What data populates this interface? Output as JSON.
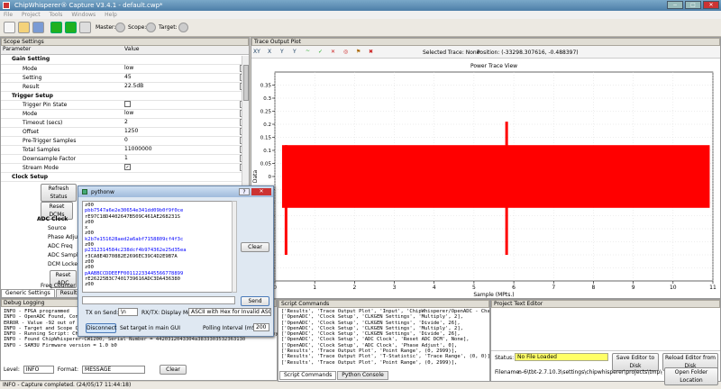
{
  "window": {
    "title": "ChipWhisperer® Capture V3.4.1 - default.cwp*",
    "minimize": "−",
    "maximize": "□",
    "close": "✕"
  },
  "menu": [
    "File",
    "Project",
    "Tools",
    "Windows",
    "Help"
  ],
  "toolbar": {
    "master_label": "Master:",
    "scope_label": "Scope:",
    "target_label": "Target:"
  },
  "scope_settings": {
    "title": "Scope Settings",
    "col_param": "Parameter",
    "col_value": "Value",
    "rows": [
      {
        "label": "Gain Setting",
        "value": "",
        "section": true,
        "indent": 1
      },
      {
        "label": "Mode",
        "value": "low",
        "indent": 2,
        "q": true
      },
      {
        "label": "Setting",
        "value": "45",
        "indent": 2,
        "q": true
      },
      {
        "label": "Result",
        "value": "22.5dB",
        "indent": 2,
        "q": true
      },
      {
        "label": "Trigger Setup",
        "value": "",
        "section": true,
        "indent": 1
      },
      {
        "label": "Trigger Pin State",
        "value": "",
        "indent": 2,
        "q": true,
        "chk": true
      },
      {
        "label": "Mode",
        "value": "low",
        "indent": 2,
        "q": true
      },
      {
        "label": "Timeout (secs)",
        "value": "2",
        "indent": 2,
        "q": true
      },
      {
        "label": "Offset",
        "value": "1250",
        "indent": 2,
        "q": true
      },
      {
        "label": "Pre-Trigger Samples",
        "value": "0",
        "indent": 2,
        "q": true
      },
      {
        "label": "Total Samples",
        "value": "11000000",
        "indent": 2,
        "q": true
      },
      {
        "label": "Downsample Factor",
        "value": "1",
        "indent": 2,
        "q": true
      },
      {
        "label": "Stream Mode",
        "value": "✓",
        "indent": 2,
        "q": true,
        "chk": true
      },
      {
        "label": "Clock Setup",
        "value": "",
        "section": true,
        "indent": 1
      }
    ],
    "refresh_status": "Refresh Status",
    "reset_dcms": "Reset DCMs",
    "adc_clock": "ADC Clock",
    "adc_rows": [
      "Source",
      "Phase Adjust",
      "ADC Freq",
      "ADC Sample",
      "DCM Locked"
    ],
    "reset_adc": "Reset ADC",
    "freq_counter": "Freq Counter",
    "tabs": [
      "Generic Settings",
      "Results"
    ]
  },
  "debug": {
    "title": "Debug Logging",
    "lines": [
      "INFO - FPGA programmed",
      "INFO - OpenADC Found, Connecting",
      "ERROR - Value -92 out of limits (",
      "INFO - Target and Scope Connected",
      "INFO - Running Script: ChipWhisperer/software/chipwhisperer/capture/scripts/setup_generic.py",
      "INFO - Found ChipWhisperer-CW1200, Serial Number = 4420312043304a3833303532363130",
      "INFO - SAM3U Firmware version = 1.0 b0"
    ],
    "level_label": "Level:",
    "level_value": "INFO",
    "format_label": "Format:",
    "format_value": "MESSAGE",
    "clear": "Clear"
  },
  "status_bar": "INFO - Capture completed. (24/05/17 11:44:18)",
  "trace_plot": {
    "title": "Trace Output Plot",
    "selected": "Selected Trace: None",
    "position": "Position: (-33298.307616, -0.488397)",
    "tool_icons": [
      "XY",
      "X",
      "Y",
      "Y",
      "~",
      "✓",
      "✕",
      "◎",
      "⚑",
      "✖"
    ]
  },
  "chart_data": {
    "type": "line",
    "title": "Power Trace View",
    "xlabel": "Sample (MPts.)",
    "ylabel": "Data",
    "xlim": [
      0,
      11
    ],
    "ylim": [
      -0.4,
      0.4
    ],
    "xticks": [
      0,
      1,
      2,
      3,
      4,
      5,
      6,
      7,
      8,
      9,
      10,
      11
    ],
    "yticks": [
      0.35,
      0.3,
      0.25,
      0.2,
      0.15,
      0.1,
      0.05,
      0,
      -0.05,
      -0.1,
      -0.15,
      -0.2,
      -0.25,
      -0.3,
      -0.35
    ],
    "series": [
      {
        "envelope_upper": 0.12,
        "envelope_lower": -0.12,
        "spikes": [
          {
            "x": 0.28,
            "min": -0.3,
            "max": 0.12
          },
          {
            "x": 5.82,
            "min": -0.3,
            "max": 0.21
          }
        ],
        "color": "#ff0000"
      }
    ],
    "grid": true
  },
  "script_commands": {
    "title": "Script Commands",
    "lines": [
      "['Results', 'Trace Output Plot', 'Input', 'ChipWhisperer/OpenADC - Channel 1'],",
      "['OpenADC', 'Clock Setup', 'CLKGEN Settings', 'Multiply', 2],",
      "['OpenADC', 'Clock Setup', 'CLKGEN Settings', 'Divide', 26],",
      "['OpenADC', 'Clock Setup', 'CLKGEN Settings', 'Multiply', 2],",
      "['OpenADC', 'Clock Setup', 'CLKGEN Settings', 'Divide', 26],",
      "['OpenADC', 'Clock Setup', 'ADC Clock', 'Reset ADC DCM', None],",
      "['OpenADC', 'Clock Setup', 'ADC Clock', 'Phase Adjust', 0],",
      "['Results', 'Trace Output Plot', 'Point Range', (0, 2999)],",
      "['Results', 'Trace Output Plot', 'T-Statistic', 'Trace Range', (0, 0)],",
      "['Results', 'Trace Output Plot', 'Point Range', (0, 2999)],"
    ],
    "tabs": [
      "Script Commands",
      "Python Console"
    ]
  },
  "project_editor": {
    "title": "Project Text Editor",
    "status_label": "Status:",
    "status_value": "No File Loaded",
    "save_btn": "Save Editor to Disk",
    "reload_btn": "Reload Editor from Disk",
    "filename_label": "Filename:",
    "filename_value": "n-6\\tbt-2.7.10.3\\settings\\chipwhisperer\\projects\\tmp\\default.cwp",
    "open_btn": "Open Folder Location"
  },
  "pythonw": {
    "title": "pythonw",
    "lines": [
      {
        "t": "z00",
        "c": "#000"
      },
      {
        "t": "pbb7547a6e2e30654e341dd09b0f9f0ce",
        "c": "#00f"
      },
      {
        "t": "rE97C18D4402647B509C461AE268231S",
        "c": "#000"
      },
      {
        "t": "z00",
        "c": "#000"
      },
      {
        "t": "x",
        "c": "#000"
      },
      {
        "t": "z00",
        "c": "#000"
      },
      {
        "t": "k2b7e151628aed2a6abf7158809cf4f3c",
        "c": "#00f"
      },
      {
        "t": "z00",
        "c": "#000"
      },
      {
        "t": "p2312314584c238dcf4b974362e25d35ea",
        "c": "#00f"
      },
      {
        "t": "r3CA8E4D70882E2696EC39C4D2E9B7A",
        "c": "#000"
      },
      {
        "t": "z00",
        "c": "#000"
      },
      {
        "t": "z00",
        "c": "#000"
      },
      {
        "t": "pAABBCCDDEEFF00112233445566778899",
        "c": "#00f"
      },
      {
        "t": "rE26225B3C7401739616ADC3DA436380",
        "c": "#000"
      },
      {
        "t": "z00",
        "c": "#000"
      }
    ],
    "clear": "Clear",
    "send": "Send",
    "tx_label": "TX on Send:",
    "tx_value": "\\n",
    "rx_label": "RX/TX: Display Mode",
    "rx_value": "ASCII with Hex for Invalid ASCII",
    "disconnect": "Disconnect",
    "set_target": "Set target in main GUI",
    "polling_label": "Polling Interval (mS)",
    "polling_value": "200"
  }
}
